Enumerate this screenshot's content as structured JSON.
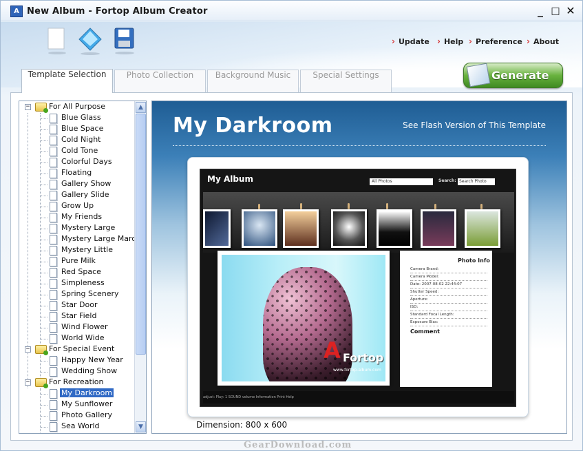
{
  "window": {
    "title": "New Album - Fortop Album Creator",
    "icon_text": "A",
    "controls": [
      "_",
      "□",
      "✕"
    ]
  },
  "toolbar": {
    "icons": [
      "new-page-icon",
      "open-diamond-icon",
      "save-disk-icon"
    ],
    "menu": [
      "Update",
      "Help",
      "Preference",
      "About"
    ]
  },
  "tabs": [
    "Template Selection",
    "Photo Collection",
    "Background Music",
    "Special Settings"
  ],
  "generate_label": "Generate",
  "tree": {
    "groups": [
      {
        "label": "For All Purpose",
        "expand": "−",
        "items": [
          "Blue Glass",
          "Blue Space",
          "Cold Night",
          "Cold Tone",
          "Colorful Days",
          "Floating",
          "Gallery Show",
          "Gallery Slide",
          "Grow Up",
          "My Friends",
          "Mystery Large",
          "Mystery Large Marc",
          "Mystery Little",
          "Pure Milk",
          "Red Space",
          "Simpleness",
          "Spring Scenery",
          "Star Door",
          "Star Field",
          "Wind Flower",
          "World Wide"
        ]
      },
      {
        "label": "For Special Event",
        "expand": "−",
        "items": [
          "Happy New Year",
          "Wedding Show"
        ]
      },
      {
        "label": "For Recreation",
        "expand": "−",
        "items": [
          "My Darkroom",
          "My Sunflower",
          "Photo Gallery",
          "Sea World"
        ]
      }
    ],
    "selected": "My Darkroom"
  },
  "preview": {
    "title": "My Darkroom",
    "flash_link": "See Flash Version of This Template",
    "dimension": "Dimension: 800 x 600",
    "album": {
      "title": "My Album",
      "dropdown": "All Photos",
      "search_label": "Search:",
      "search_placeholder": "Search Photo",
      "brand_letter": "A",
      "brand_name": "Fortop",
      "url": "www.fortop-album.com",
      "info_title": "Photo Info",
      "info_fields": [
        "Camera Brand:",
        "Camera Model:",
        "Date: 2007-08-02 22:44:07",
        "Shutter Speed:",
        "Aperture:",
        "ISO:",
        "Standard Focal Length:",
        "Exposure Bias:"
      ],
      "comment_label": "Comment",
      "controls_text": "adjust:     Play:    1    SOUND    volume     Information  Print  Help"
    }
  },
  "watermark": "GearDownload.com"
}
